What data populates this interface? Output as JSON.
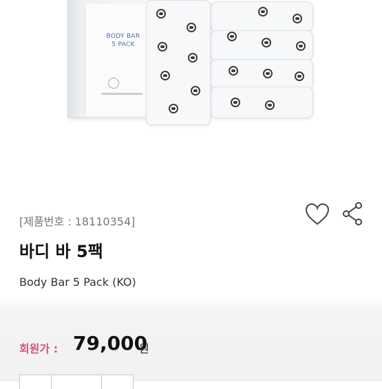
{
  "product_image": {
    "box_label": "BODY BAR\n5 PACK"
  },
  "product": {
    "code": "[제품번호 : 18110354]",
    "title": "바디 바 5팩",
    "subtitle": "Body Bar 5 Pack (KO)"
  },
  "actions": {
    "wishlist_icon": "heart-icon",
    "share_icon": "share-icon"
  },
  "price": {
    "label": "회원가 :",
    "value": "79,000",
    "unit": "원"
  },
  "colors": {
    "price_label": "#d0567a",
    "icon_stroke": "#444444",
    "box_text": "#4b6ea5"
  }
}
